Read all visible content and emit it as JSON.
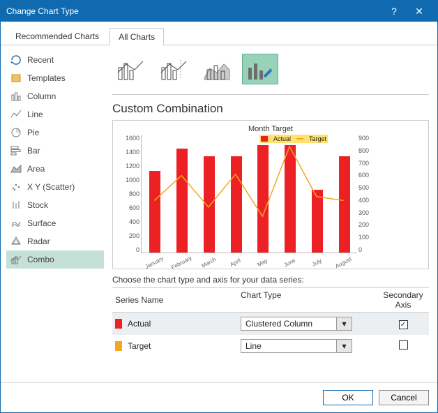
{
  "title": "Change Chart Type",
  "tabs": {
    "recommended": "Recommended Charts",
    "all": "All Charts"
  },
  "sidebar": {
    "items": [
      {
        "label": "Recent"
      },
      {
        "label": "Templates"
      },
      {
        "label": "Column"
      },
      {
        "label": "Line"
      },
      {
        "label": "Pie"
      },
      {
        "label": "Bar"
      },
      {
        "label": "Area"
      },
      {
        "label": "X Y (Scatter)"
      },
      {
        "label": "Stock"
      },
      {
        "label": "Surface"
      },
      {
        "label": "Radar"
      },
      {
        "label": "Combo"
      }
    ]
  },
  "section_title": "Custom Combination",
  "chart_title": "Month Target",
  "legend": {
    "s1": "Actual",
    "s2": "Target"
  },
  "series_prompt": "Choose the chart type and axis for your data series:",
  "table": {
    "h_name": "Series Name",
    "h_type": "Chart Type",
    "h_sec": "Secondary Axis",
    "rows": [
      {
        "name": "Actual",
        "type": "Clustered Column",
        "color": "#ed2024",
        "sec": true
      },
      {
        "name": "Target",
        "type": "Line",
        "color": "#f5a623",
        "sec": false
      }
    ]
  },
  "buttons": {
    "ok": "OK",
    "cancel": "Cancel"
  },
  "chart_data": {
    "type": "combo",
    "title": "Month Target",
    "categories": [
      "January",
      "February",
      "March",
      "April",
      "May",
      "June",
      "July",
      "August"
    ],
    "series": [
      {
        "name": "Actual",
        "type": "bar",
        "axis": "primary",
        "color": "#ed2024",
        "values": [
          1100,
          1400,
          1300,
          1300,
          1450,
          1450,
          850,
          1300
        ]
      },
      {
        "name": "Target",
        "type": "line",
        "axis": "secondary",
        "color": "#f5a623",
        "values": [
          400,
          590,
          350,
          600,
          280,
          810,
          430,
          400
        ]
      }
    ],
    "y1": {
      "min": 0,
      "max": 1600,
      "step": 200,
      "label": ""
    },
    "y2": {
      "min": 0,
      "max": 900,
      "step": 100,
      "label": ""
    },
    "xlabel": "",
    "legend_position": "top"
  }
}
